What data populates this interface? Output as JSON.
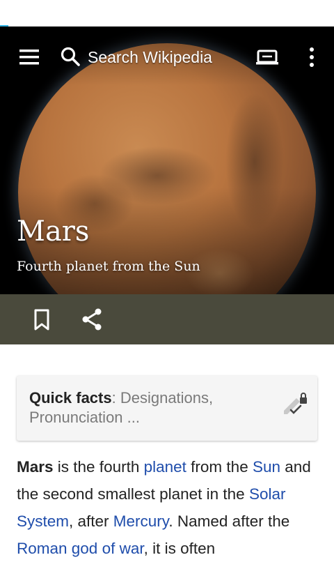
{
  "toolbar": {
    "search_placeholder": "Search Wikipedia",
    "icons": [
      "menu-icon",
      "search-icon",
      "reading-lists-icon",
      "overflow-icon"
    ]
  },
  "header": {
    "title": "Mars",
    "subtitle": "Fourth planet from the Sun"
  },
  "actions": {
    "icons": [
      "bookmark-icon",
      "share-icon"
    ]
  },
  "quick_facts": {
    "label": "Quick facts",
    "separator": ": ",
    "items": "Designations, Pronunciation ...",
    "icon": "edit-lock-icon"
  },
  "article": {
    "p1": "Mars",
    "p2": " is the fourth ",
    "link_planet": "planet",
    "p3": " from the ",
    "link_sun": "Sun",
    "p4": " and the second smallest planet in the ",
    "link_solar_system": "Solar System",
    "p5": ", after ",
    "link_mercury": "Mercury",
    "p6": ". Named after the ",
    "link_roman_god": "Roman god of war",
    "p7": ", it is often"
  },
  "colors": {
    "link": "#1f4dab",
    "action_bar": "#4a4a3c",
    "status_accent": "#33b5e5"
  }
}
